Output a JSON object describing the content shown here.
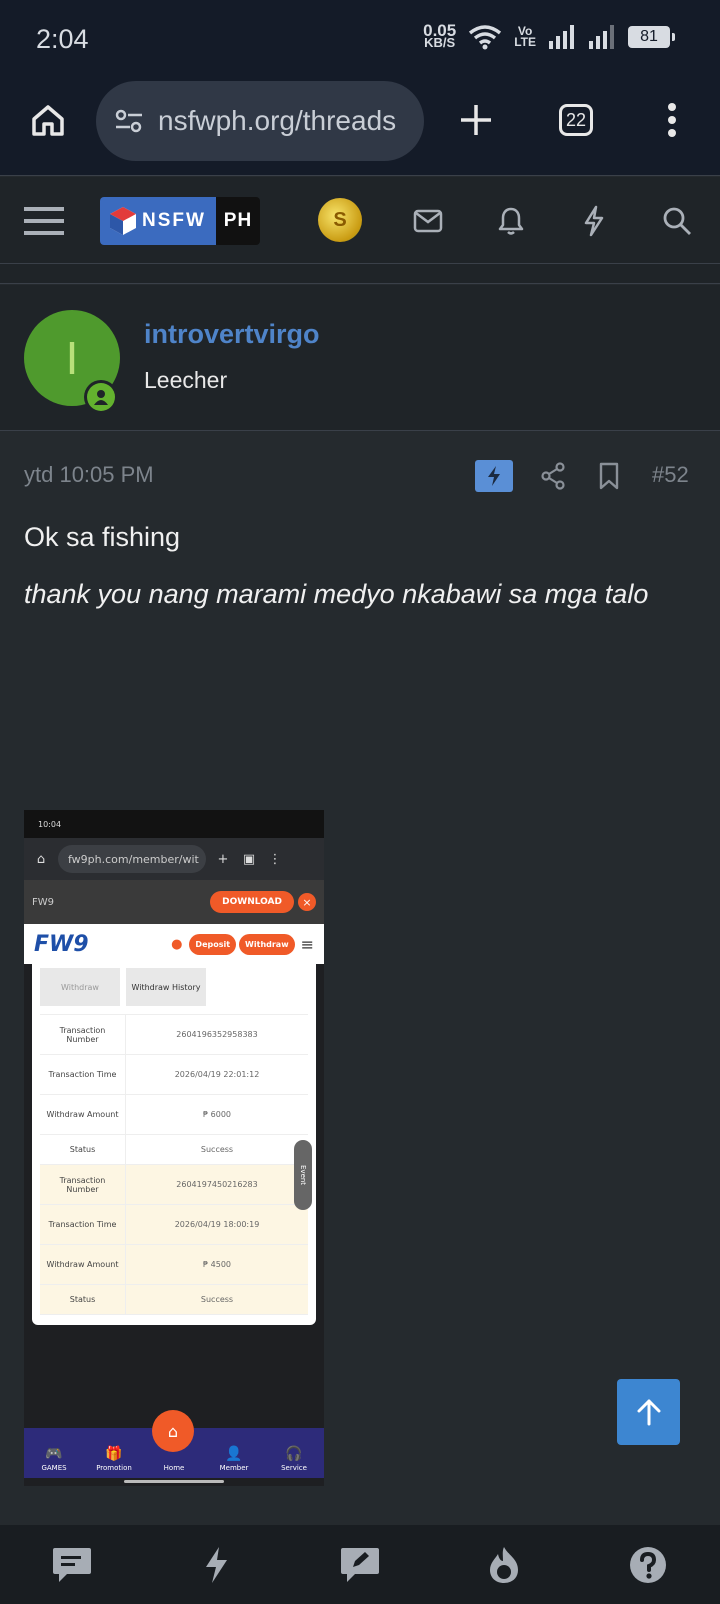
{
  "status_bar": {
    "time": "2:04",
    "net_speed": "0.05",
    "net_unit": "KB/S",
    "lte_top": "Vo",
    "lte_bottom": "LTE",
    "battery": "81"
  },
  "browser": {
    "url": "nsfwph.org/threads",
    "tab_count": "22"
  },
  "site": {
    "logo_left": "NSFW",
    "logo_right": "PH"
  },
  "user": {
    "initial": "I",
    "name": "introvertvirgo",
    "title": "Leecher"
  },
  "post": {
    "date": "ytd 10:05 PM",
    "number": "#52",
    "line1": "Ok sa fishing",
    "line2": "thank you nang marami medyo nkabawi sa mga talo"
  },
  "embedded_screenshot": {
    "status_time": "10:04",
    "url": "fw9ph.com/member/wit",
    "top_label": "FW9",
    "download": "DOWNLOAD",
    "logo": "FW9",
    "deposit": "Deposit",
    "withdraw": "Withdraw",
    "tab_withdraw": "Withdraw",
    "tab_history": "Withdraw History",
    "rows": [
      {
        "k": "Transaction Number",
        "v": "2604196352958383"
      },
      {
        "k": "Transaction Time",
        "v": "2026/04/19 22:01:12"
      },
      {
        "k": "Withdraw Amount",
        "v": "₱ 6000"
      },
      {
        "k": "Status",
        "v": "Success"
      },
      {
        "k": "Transaction Number",
        "v": "2604197450216283"
      },
      {
        "k": "Transaction Time",
        "v": "2026/04/19 18:00:19"
      },
      {
        "k": "Withdraw Amount",
        "v": "₱ 4500"
      },
      {
        "k": "Status",
        "v": "Success"
      }
    ],
    "event": "Event",
    "nav": [
      "GAMES",
      "Promotion",
      "Home",
      "Member",
      "Service"
    ]
  },
  "colors": {
    "accent": "#3d86d1",
    "username": "#4f84c9",
    "online": "#63b22e",
    "background": "#252a2e"
  }
}
